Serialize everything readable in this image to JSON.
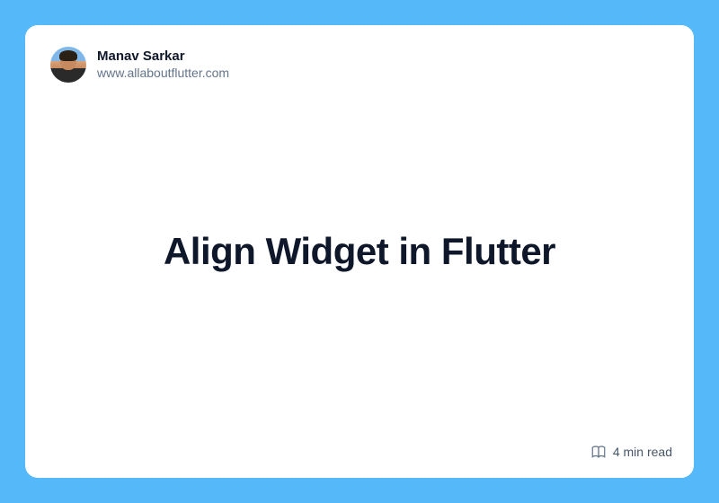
{
  "author": {
    "name": "Manav Sarkar",
    "site": "www.allaboutflutter.com"
  },
  "title": "Align Widget in Flutter",
  "readTime": "4 min read"
}
